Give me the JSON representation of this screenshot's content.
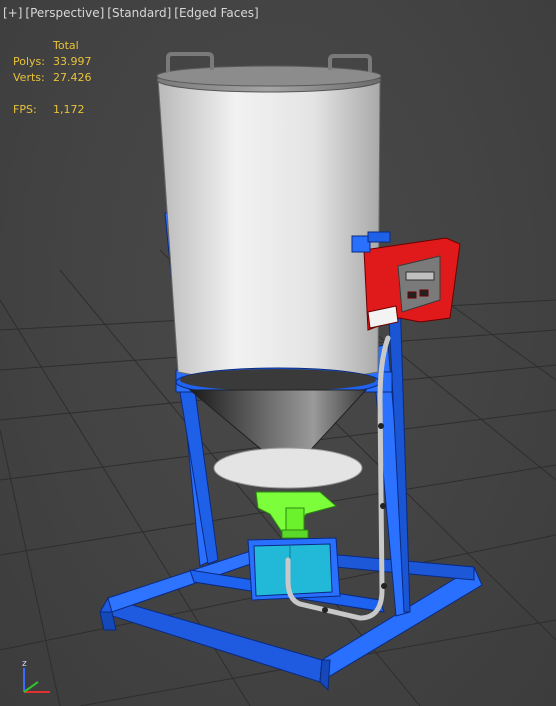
{
  "viewport": {
    "menu": [
      "[+]",
      "[Perspective]",
      "[Standard]",
      "[Edged Faces]"
    ]
  },
  "stats": {
    "header": "Total",
    "polys_label": "Polys:",
    "polys_value": "33.997",
    "verts_label": "Verts:",
    "verts_value": "27.426",
    "fps_label": "FPS:",
    "fps_value": "1,172"
  },
  "axis_gizmo": {
    "z_label": "z"
  },
  "colors": {
    "stats_text": "#e8c33a",
    "frame_blue": "#1e6bff",
    "panel_red": "#e01a1a",
    "motor_green": "#7cff3a",
    "box_cyan": "#22b8d8",
    "tank_white": "#e6e6e6"
  }
}
